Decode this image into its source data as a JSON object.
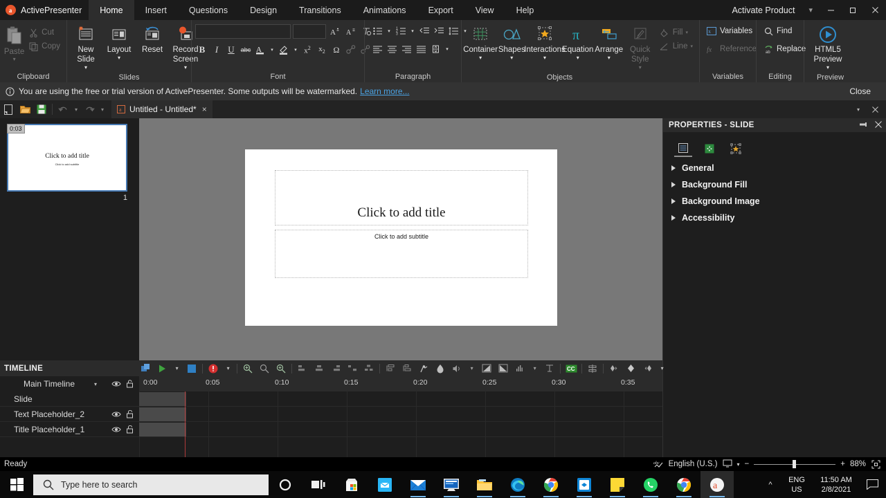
{
  "titlebar": {
    "app_name": "ActivePresenter",
    "logo_letter": "a",
    "tabs": [
      {
        "label": "Home",
        "active": true
      },
      {
        "label": "Insert",
        "active": false
      },
      {
        "label": "Questions",
        "active": false
      },
      {
        "label": "Design",
        "active": false
      },
      {
        "label": "Transitions",
        "active": false
      },
      {
        "label": "Animations",
        "active": false
      },
      {
        "label": "Export",
        "active": false
      },
      {
        "label": "View",
        "active": false
      },
      {
        "label": "Help",
        "active": false
      }
    ],
    "activate_label": "Activate Product",
    "minimize": "minimize-icon",
    "maximize": "maximize-icon",
    "close": "close-icon"
  },
  "ribbon": {
    "groups": [
      {
        "name": "Clipboard",
        "label": "Clipboard"
      },
      {
        "name": "Slides",
        "label": "Slides"
      },
      {
        "name": "Font",
        "label": "Font"
      },
      {
        "name": "Paragraph",
        "label": "Paragraph"
      },
      {
        "name": "Objects",
        "label": "Objects"
      },
      {
        "name": "Variables",
        "label": "Variables"
      },
      {
        "name": "Editing",
        "label": "Editing"
      },
      {
        "name": "Preview",
        "label": "Preview"
      }
    ],
    "clipboard": {
      "paste": "Paste",
      "cut": "Cut",
      "copy": "Copy"
    },
    "slides": {
      "new_slide": "New Slide",
      "layout": "Layout",
      "reset": "Reset",
      "record_screen": "Record Screen"
    },
    "font": {
      "font_family_value": "",
      "font_size_value": "",
      "grow_font": "A",
      "shrink_font": "A",
      "clear_format": "clear-formatting-icon",
      "bold": "B",
      "italic": "I",
      "underline": "U",
      "strikethrough": "abc",
      "font_color": "A",
      "highlight": "ab",
      "superscript": "x²",
      "subscript": "x₂",
      "symbol": "Ω",
      "insert_link": "link-icon",
      "remove_link": "unlink-icon"
    },
    "objects": {
      "container": "Container",
      "shapes": "Shapes",
      "interactions": "Interactions",
      "equation": "Equation",
      "arrange": "Arrange",
      "quick_style": "Quick Style",
      "fill": "Fill",
      "line": "Line"
    },
    "variables": {
      "variables": "Variables",
      "reference": "Reference"
    },
    "editing": {
      "find": "Find",
      "replace": "Replace"
    },
    "preview": {
      "html5_preview": "HTML5 Preview"
    }
  },
  "notice": {
    "text": "You are using the free or trial version of ActivePresenter. Some outputs will be watermarked.",
    "link": "Learn more...",
    "close_label": "Close"
  },
  "quick_access": {
    "buttons": [
      "new-icon",
      "open-icon",
      "save-icon",
      "undo-icon",
      "undo-dropdown-icon",
      "redo-icon",
      "redo-dropdown-icon"
    ],
    "document_tab": "Untitled - Untitled*",
    "tab_close": "×"
  },
  "slide_list": {
    "slides": [
      {
        "number": "1",
        "duration": "0:03",
        "title": "Click to add title",
        "subtitle": "Click to add subtitle"
      }
    ]
  },
  "canvas": {
    "title_placeholder": "Click to add title",
    "subtitle_placeholder": "Click to add subtitle"
  },
  "properties": {
    "header": "PROPERTIES - SLIDE",
    "tabs": [
      "slide-properties-icon",
      "slide-transition-icon",
      "slide-interactivity-icon"
    ],
    "sections": [
      {
        "label": "General"
      },
      {
        "label": "Background Fill"
      },
      {
        "label": "Background Image"
      },
      {
        "label": "Accessibility"
      }
    ]
  },
  "timeline": {
    "title": "TIMELINE",
    "main_timeline_label": "Main Timeline",
    "ruler_ticks": [
      "0:00",
      "0:05",
      "0:10",
      "0:15",
      "0:20",
      "0:25",
      "0:30",
      "0:35"
    ],
    "rows": [
      {
        "label": "Slide",
        "has_eye": false,
        "has_lock": false
      },
      {
        "label": "Text Placeholder_2",
        "has_eye": true,
        "has_lock": true
      },
      {
        "label": "Title Placeholder_1",
        "has_eye": true,
        "has_lock": true
      }
    ],
    "tools": [
      "select-objects-icon",
      "play-icon",
      "play-dropdown-icon",
      "stop-icon",
      "record-icon",
      "record-dropdown-icon",
      "zoom-to-fit-icon",
      "zoom-out-icon",
      "zoom-in-icon"
    ]
  },
  "statusbar": {
    "ready": "Ready",
    "spell_icon": "spellcheck-icon",
    "language": "English (U.S.)",
    "display_icon": "display-mode-icon",
    "zoom_out": "−",
    "zoom_in": "+",
    "zoom_value": "88%",
    "fit_icon": "fit-to-window-icon"
  },
  "taskbar": {
    "start": "start-icon",
    "search_placeholder": "Type here to search",
    "cortana": "cortana-icon",
    "task_view": "task-view-icon",
    "apps": [
      {
        "name": "microsoft-store-icon",
        "running": false
      },
      {
        "name": "mail-blue-icon",
        "running": false
      },
      {
        "name": "mail-icon",
        "running": true
      },
      {
        "name": "remote-desktop-icon",
        "running": true
      },
      {
        "name": "file-explorer-icon",
        "running": true
      },
      {
        "name": "microsoft-edge-icon",
        "running": true
      },
      {
        "name": "google-chrome-icon",
        "running": true
      },
      {
        "name": "teamviewer-icon",
        "running": true
      },
      {
        "name": "sticky-notes-icon",
        "running": true
      },
      {
        "name": "whatsapp-icon",
        "running": true
      },
      {
        "name": "chrome-2-icon",
        "running": true
      },
      {
        "name": "activepresenter-icon",
        "running": true,
        "active": true
      }
    ],
    "tray_chevron": "show-hidden-icons-icon",
    "language_line1": "ENG",
    "language_line2": "US",
    "time": "11:50 AM",
    "date": "2/8/2021",
    "action_center": "action-center-icon"
  }
}
